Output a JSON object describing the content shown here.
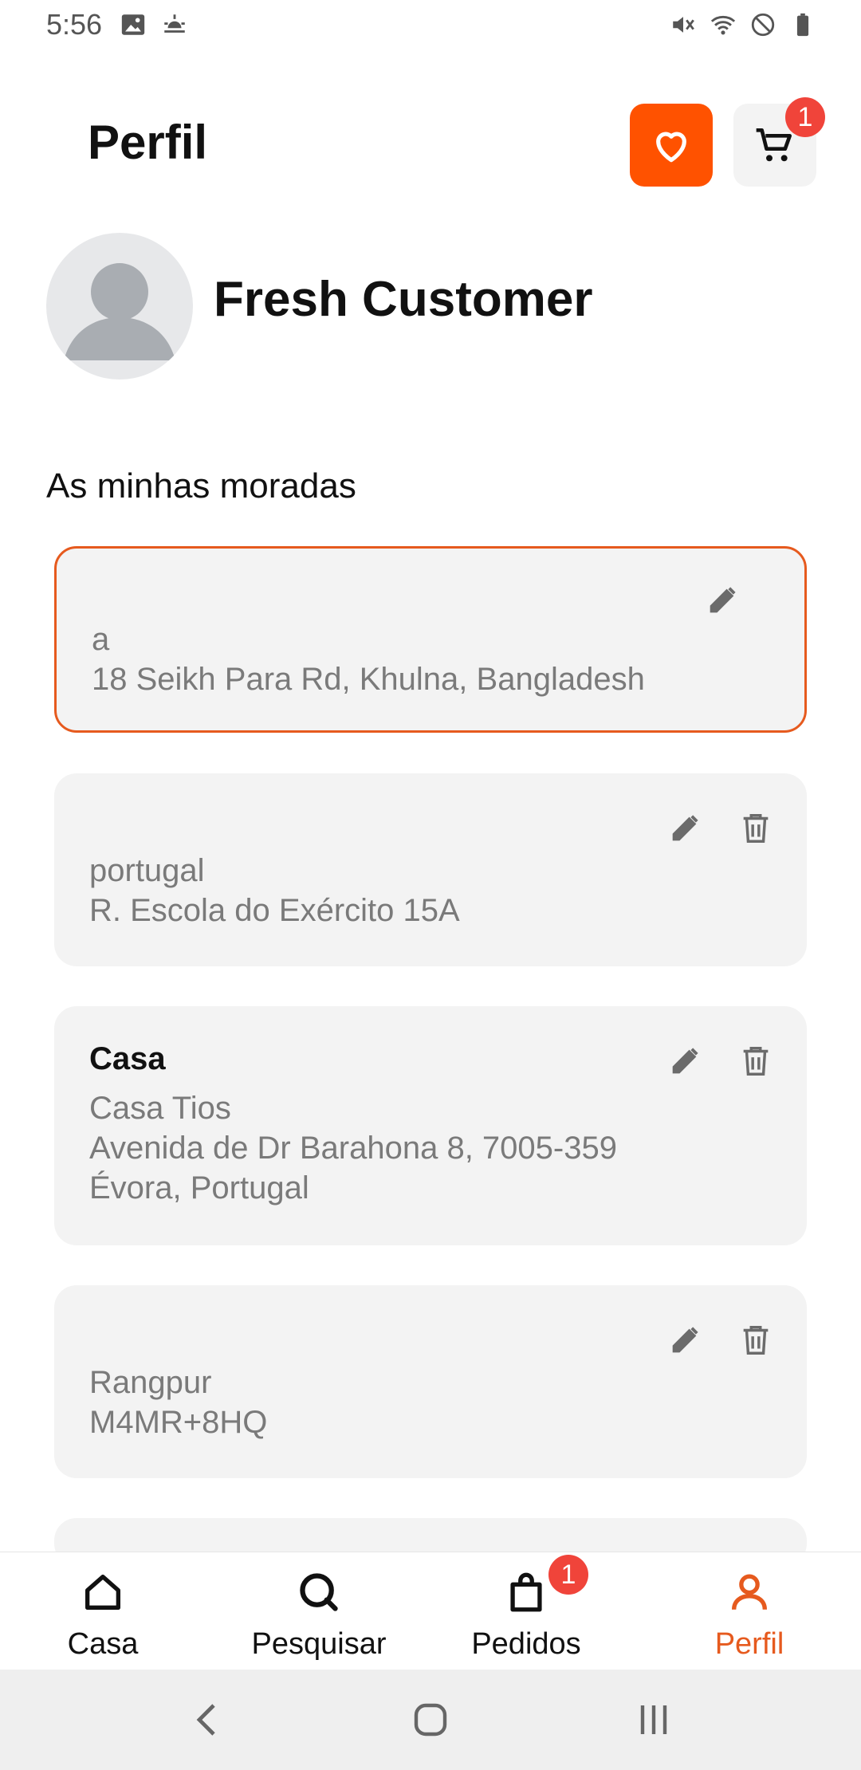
{
  "status_bar": {
    "time": "5:56",
    "left_icons": [
      "image-icon",
      "weather-icon"
    ],
    "right_icons": [
      "mute-icon",
      "wifi-icon",
      "do-not-disturb-icon",
      "battery-icon"
    ]
  },
  "header": {
    "title": "Perfil",
    "favorites_icon": "heart-icon",
    "cart_icon": "cart-icon",
    "cart_badge": "1"
  },
  "profile": {
    "name": "Fresh Customer",
    "avatar_icon": "avatar-placeholder"
  },
  "addresses": {
    "section_title": "As minhas moradas",
    "items": [
      {
        "label": "",
        "lines": [
          "a",
          "18 Seikh Para Rd, Khulna, Bangladesh"
        ],
        "selected": true,
        "deletable": false
      },
      {
        "label": "",
        "lines": [
          "portugal",
          "R. Escola do Exército 15A"
        ],
        "selected": false,
        "deletable": true
      },
      {
        "label": "Casa",
        "lines": [
          "Casa Tios",
          "Avenida de Dr Barahona 8, 7005-359",
          "Évora, Portugal"
        ],
        "selected": false,
        "deletable": true
      },
      {
        "label": "",
        "lines": [
          "Rangpur",
          "M4MR+8HQ"
        ],
        "selected": false,
        "deletable": true
      }
    ]
  },
  "bottom_nav": {
    "items": [
      {
        "label": "Casa",
        "icon": "home-icon",
        "active": false
      },
      {
        "label": "Pesquisar",
        "icon": "search-icon",
        "active": false
      },
      {
        "label": "Pedidos",
        "icon": "bag-icon",
        "active": false,
        "badge": "1"
      },
      {
        "label": "Perfil",
        "icon": "person-icon",
        "active": true
      }
    ]
  },
  "colors": {
    "accent": "#FF5200",
    "accent_text": "#E65A1E",
    "badge": "#F0443A",
    "card_bg": "#F3F3F3",
    "muted_text": "#7A7A7A"
  }
}
